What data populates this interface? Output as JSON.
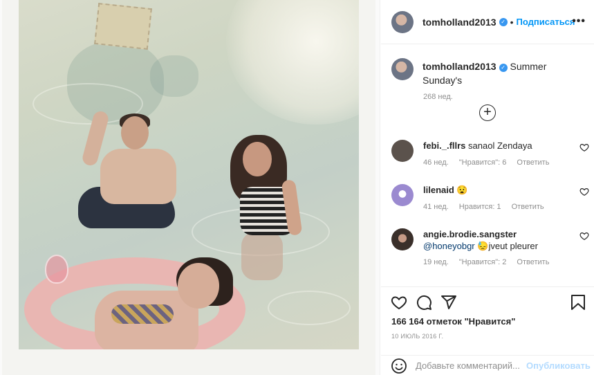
{
  "post": {
    "username": "tomholland2013",
    "verified_mark": "✓",
    "follow_label": "Подписаться",
    "dot": "•",
    "more_label": "•••",
    "image_alt": "photo"
  },
  "caption": {
    "username": "tomholland2013",
    "text": "Summer Sunday's",
    "time": "268 нед."
  },
  "load_more_label": "+",
  "comments": [
    {
      "username": "febi._.fllrs",
      "text": "sanaol Zendaya",
      "time": "46 нед.",
      "likes": "\"Нравится\": 6",
      "reply": "Ответить",
      "avatar_color": "#5b524c"
    },
    {
      "username": "lilenaid",
      "text": "😧",
      "time": "41 нед.",
      "likes": "Нравится: 1",
      "reply": "Ответить",
      "avatar_color": "#9b8ad0"
    },
    {
      "username": "angie.brodie.sangster",
      "mention": "@honeyobgr",
      "text": "😓jveut pleurer",
      "time": "19 нед.",
      "likes": "\"Нравится\": 2",
      "reply": "Ответить",
      "avatar_color": "#3a2f2a"
    }
  ],
  "actions": {
    "likes_text": "166 164 отметок \"Нравится\"",
    "date": "10 ИЮЛЬ 2016 Г."
  },
  "add_comment": {
    "placeholder": "Добавьте комментарий...",
    "publish_label": "Опубликовать"
  },
  "colors": {
    "accent": "#0095f6",
    "verified": "#3897f0",
    "muted": "#8e8e8e",
    "publish_disabled": "#b3dbff"
  }
}
